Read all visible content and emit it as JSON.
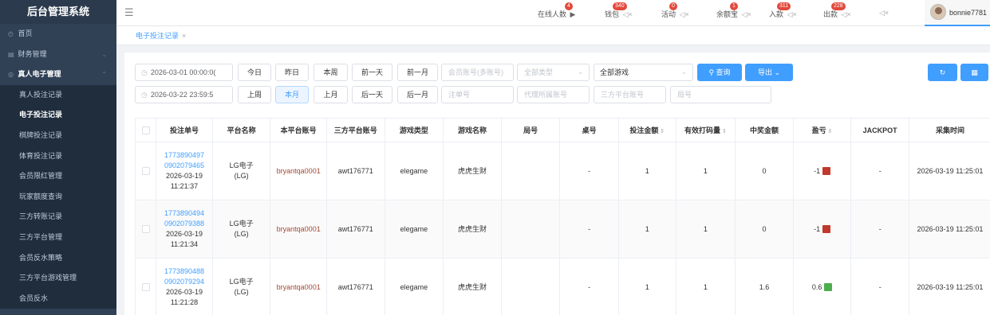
{
  "app": {
    "title": "后台管理系统"
  },
  "sidebar": {
    "items": [
      {
        "label": "首页",
        "icon": "home-icon"
      },
      {
        "label": "财务管理",
        "icon": "finance-icon"
      },
      {
        "label": "真人电子管理",
        "icon": "live-icon"
      }
    ],
    "submenu": [
      {
        "label": "真人投注记录"
      },
      {
        "label": "电子投注记录"
      },
      {
        "label": "棋牌投注记录"
      },
      {
        "label": "体育投注记录"
      },
      {
        "label": "会员限红管理"
      },
      {
        "label": "玩家额度查询"
      },
      {
        "label": "三方转账记录"
      },
      {
        "label": "三方平台管理"
      },
      {
        "label": "会员反水策略"
      },
      {
        "label": "三方平台游戏管理"
      },
      {
        "label": "会员反水"
      }
    ]
  },
  "header": {
    "stats": [
      {
        "label": "在线人数",
        "badge": "4"
      },
      {
        "label": "钱包",
        "badge": "340"
      },
      {
        "label": "活动",
        "badge": "0"
      },
      {
        "label": "余额宝",
        "badge": "1"
      },
      {
        "label": "入款",
        "badge": "311"
      },
      {
        "label": "出款",
        "badge": "228"
      }
    ],
    "username": "bonnie7781"
  },
  "tabs": {
    "active": "电子投注记录"
  },
  "filters": {
    "start_time": "2026-03-01 00:00:0(",
    "end_time": "2026-03-22 23:59:5",
    "quick_row1": [
      "今日",
      "昨日",
      "本周",
      "前一天",
      "前一月"
    ],
    "quick_row2": [
      "上周",
      "本月",
      "上月",
      "后一天",
      "后一月"
    ],
    "member_ph": "会员账号(多账号)",
    "type_ph": "全部类型",
    "game_value": "全部游戏",
    "query_label": "查询",
    "export_label": "导出",
    "note_ph": "注单号",
    "agent_ph": "代理所属账号",
    "third_ph": "三方平台账号",
    "round_ph": "局号"
  },
  "table": {
    "headers": [
      "投注单号",
      "平台名称",
      "本平台账号",
      "三方平台账号",
      "游戏类型",
      "游戏名称",
      "局号",
      "桌号",
      "投注金额",
      "有效打码量",
      "中奖金额",
      "盈亏",
      "JACKPOT",
      "采集时间"
    ],
    "rows": [
      {
        "order1": "1773890497",
        "order2": "0902079465",
        "date": "2026-03-19",
        "time": "11:21:37",
        "platform1": "LG电子",
        "platform2": "(LG)",
        "account": "bryantqa0001",
        "third": "awt176771",
        "game_type": "elegame",
        "game_name": "虎虎生财",
        "round": "",
        "table_no": "-",
        "bet": "1",
        "valid": "1",
        "win": "0",
        "pnl": "-1",
        "pnl_color": "#c0392b",
        "jackpot": "-",
        "collect": "2026-03-19 11:25:01"
      },
      {
        "order1": "1773890494",
        "order2": "0902079388",
        "date": "2026-03-19",
        "time": "11:21:34",
        "platform1": "LG电子",
        "platform2": "(LG)",
        "account": "bryantqa0001",
        "third": "awt176771",
        "game_type": "elegame",
        "game_name": "虎虎生财",
        "round": "",
        "table_no": "-",
        "bet": "1",
        "valid": "1",
        "win": "0",
        "pnl": "-1",
        "pnl_color": "#c0392b",
        "jackpot": "-",
        "collect": "2026-03-19 11:25:01"
      },
      {
        "order1": "1773890488",
        "order2": "0902079294",
        "date": "2026-03-19",
        "time": "11:21:28",
        "platform1": "LG电子",
        "platform2": "(LG)",
        "account": "bryantqa0001",
        "third": "awt176771",
        "game_type": "elegame",
        "game_name": "虎虎生财",
        "round": "",
        "table_no": "-",
        "bet": "1",
        "valid": "1",
        "win": "1.6",
        "pnl": "0.6",
        "pnl_color": "#4cae4c",
        "jackpot": "-",
        "collect": "2026-03-19 11:25:01"
      }
    ]
  }
}
